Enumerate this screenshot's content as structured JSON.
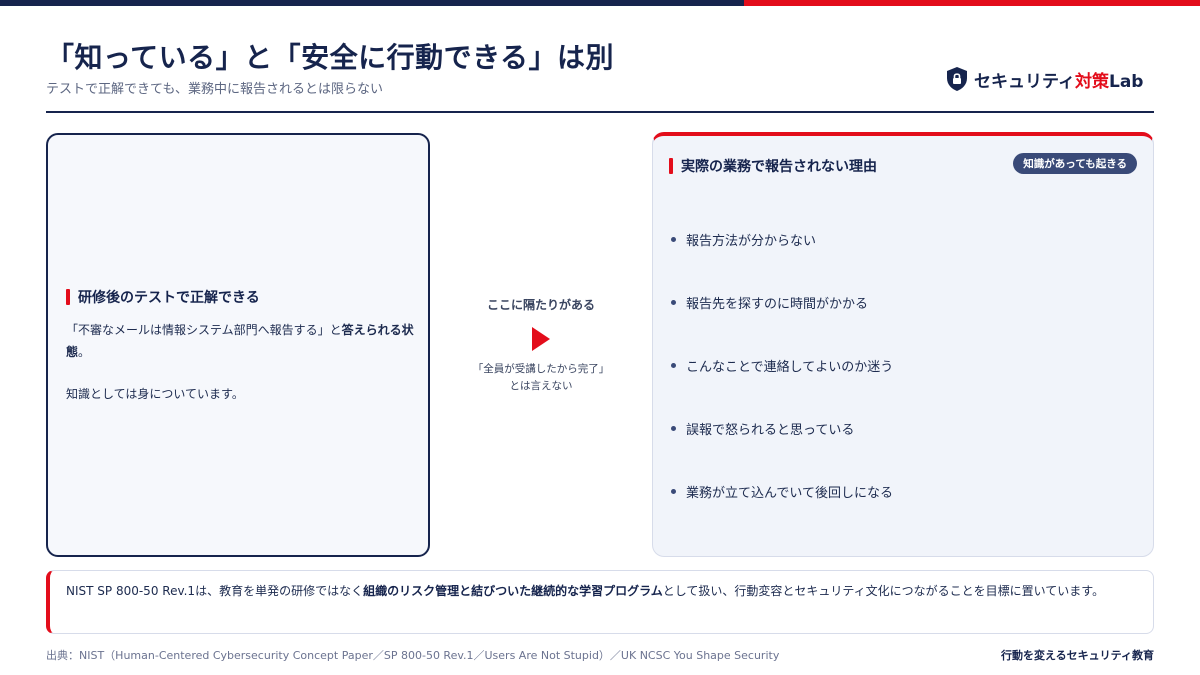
{
  "header": {
    "title": "「知っている」と「安全に行動できる」は別",
    "subtitle": "テストで正解できても、業務中に報告されるとは限らない"
  },
  "logo": {
    "icon": "shield-lock-icon",
    "name_main": "セキュリティ",
    "name_accent": "対策",
    "name_tail": "Lab"
  },
  "left_card": {
    "heading": "研修後のテストで正解できる",
    "quote": "「不審なメールは情報システム部門へ報告する」と",
    "quote_emphasis": "答えられる状態",
    "quote_end": "。",
    "note": "知識としては身についています。"
  },
  "gap": {
    "label": "ここに隔たりがある",
    "note_line1": "「全員が受講したから完了」",
    "note_line2": "とは言えない"
  },
  "right_card": {
    "heading": "実際の業務で報告されない理由",
    "badge": "知識があっても起きる",
    "reasons": [
      "報告方法が分からない",
      "報告先を探すのに時間がかかる",
      "こんなことで連絡してよいのか迷う",
      "誤報で怒られると思っている",
      "業務が立て込んでいて後回しになる"
    ]
  },
  "callout": {
    "part1": "NIST SP 800-50 Rev.1は、教育を単発の研修ではなく",
    "emphasis": "組織のリスク管理と結びついた継続的な学習プログラム",
    "part2": "として扱い、行動変容とセキュリティ文化につながることを目標に置いています。"
  },
  "footer": {
    "source": "出典：NIST（Human-Centered Cybersecurity Concept Paper／SP 800-50 Rev.1／Users Are Not Stupid）／UK NCSC You Shape Security",
    "tagline": "行動を変えるセキュリティ教育"
  },
  "colors": {
    "navy": "#16244d",
    "accent_red": "#e30d1b",
    "panel_bg": "#f1f4fa"
  }
}
